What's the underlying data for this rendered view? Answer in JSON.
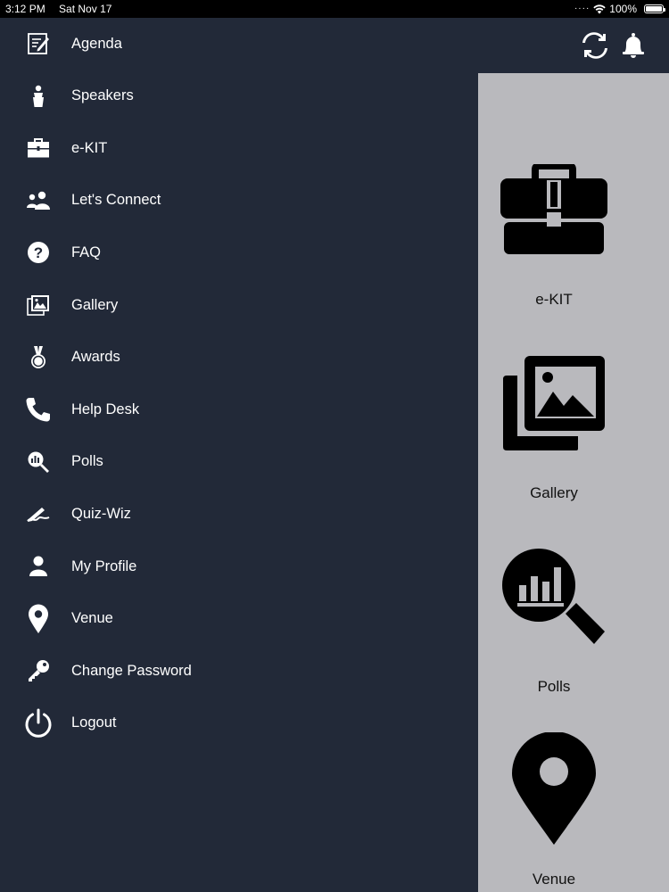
{
  "status_bar": {
    "time": "3:12 PM",
    "date": "Sat Nov 17",
    "battery": "100%"
  },
  "menu": {
    "items": [
      {
        "label": "Agenda",
        "icon": "agenda-icon"
      },
      {
        "label": "Speakers",
        "icon": "speaker-icon"
      },
      {
        "label": "e-KIT",
        "icon": "briefcase-icon"
      },
      {
        "label": "Let's Connect",
        "icon": "users-icon"
      },
      {
        "label": "FAQ",
        "icon": "question-icon"
      },
      {
        "label": "Gallery",
        "icon": "gallery-icon"
      },
      {
        "label": "Awards",
        "icon": "medal-icon"
      },
      {
        "label": "Help Desk",
        "icon": "phone-icon"
      },
      {
        "label": "Polls",
        "icon": "polls-icon"
      },
      {
        "label": "Quiz-Wiz",
        "icon": "quiz-icon"
      },
      {
        "label": "My Profile",
        "icon": "profile-icon"
      },
      {
        "label": "Venue",
        "icon": "location-pin-icon"
      },
      {
        "label": "Change Password",
        "icon": "key-icon"
      },
      {
        "label": "Logout",
        "icon": "power-icon"
      }
    ]
  },
  "topbar": {
    "icons": [
      "sync-icon",
      "bell-icon"
    ]
  },
  "tiles": [
    {
      "label": "e-KIT",
      "icon": "briefcase-icon"
    },
    {
      "label": "Gallery",
      "icon": "gallery-icon"
    },
    {
      "label": "Polls",
      "icon": "polls-icon"
    },
    {
      "label": "Venue",
      "icon": "location-pin-icon"
    }
  ],
  "colors": {
    "drawer_bg": "#222938",
    "content_bg": "#b9b9bd",
    "text": "#ffffff"
  }
}
